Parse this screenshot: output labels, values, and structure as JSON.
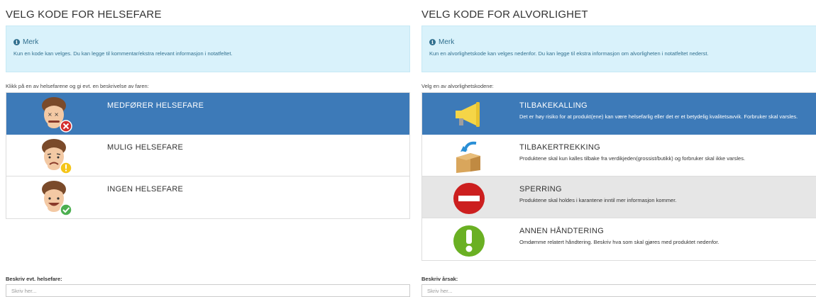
{
  "left": {
    "title": "VELG KODE FOR HELSEFARE",
    "alert": {
      "title": "Merk",
      "text": "Kun en kode kan velges. Du kan legge til kommentar/ekstra relevant informasjon i notatfeltet."
    },
    "instruction": "Klikk på en av helsefarene og gi evt. en beskrivelse av faren:",
    "items": [
      {
        "label": "MEDFØRER HELSEFARE",
        "icon": "face-sick-icon",
        "badge": "x-badge-icon"
      },
      {
        "label": "MULIG HELSEFARE",
        "icon": "face-worried-icon",
        "badge": "exclamation-badge-icon"
      },
      {
        "label": "INGEN HELSEFARE",
        "icon": "face-happy-icon",
        "badge": "check-badge-icon"
      }
    ],
    "field": {
      "label": "Beskriv evt. helsefare:",
      "placeholder": "Skriv her..."
    }
  },
  "right": {
    "title": "VELG KODE FOR ALVORLIGHET",
    "alert": {
      "title": "Merk",
      "text": "Kun en alvorlighetskode kan velges nedenfor. Du kan legge til ekstra informasjon om alvorligheten i notatfeltet nederst."
    },
    "instruction": "Velg en av alvorlighetskodene:",
    "items": [
      {
        "label": "TILBAKEKALLING",
        "desc": "Det er høy risiko for at produkt(ene) kan være helsefarlig eller det er et betydelig kvalitetsavvik. Forbruker skal varsles.",
        "icon": "megaphone-icon"
      },
      {
        "label": "TILBAKERTREKKING",
        "desc": "Produktene skal kun kalles tilbake fra verdikjeden(grossist/butikk) og forbruker skal ikke varsles.",
        "icon": "box-return-icon"
      },
      {
        "label": "SPERRING",
        "desc": "Produktene skal holdes i karantene inntil mer informasjon kommer.",
        "icon": "no-entry-icon"
      },
      {
        "label": "ANNEN HÅNDTERING",
        "desc": "Omdømme relatert håndtering. Beskriv hva som skal gjøres med produktet nedenfor.",
        "icon": "exclamation-circle-icon"
      }
    ],
    "field": {
      "label": "Beskriv årsak:",
      "placeholder": "Skriv her..."
    }
  },
  "colors": {
    "active": "#3d7ab8",
    "alert_bg": "#d9f2fb",
    "alert_text": "#31708f",
    "danger": "#d32f2f",
    "warning": "#f5c518",
    "success": "#4caf50",
    "gray_row": "#e6e6e6"
  }
}
